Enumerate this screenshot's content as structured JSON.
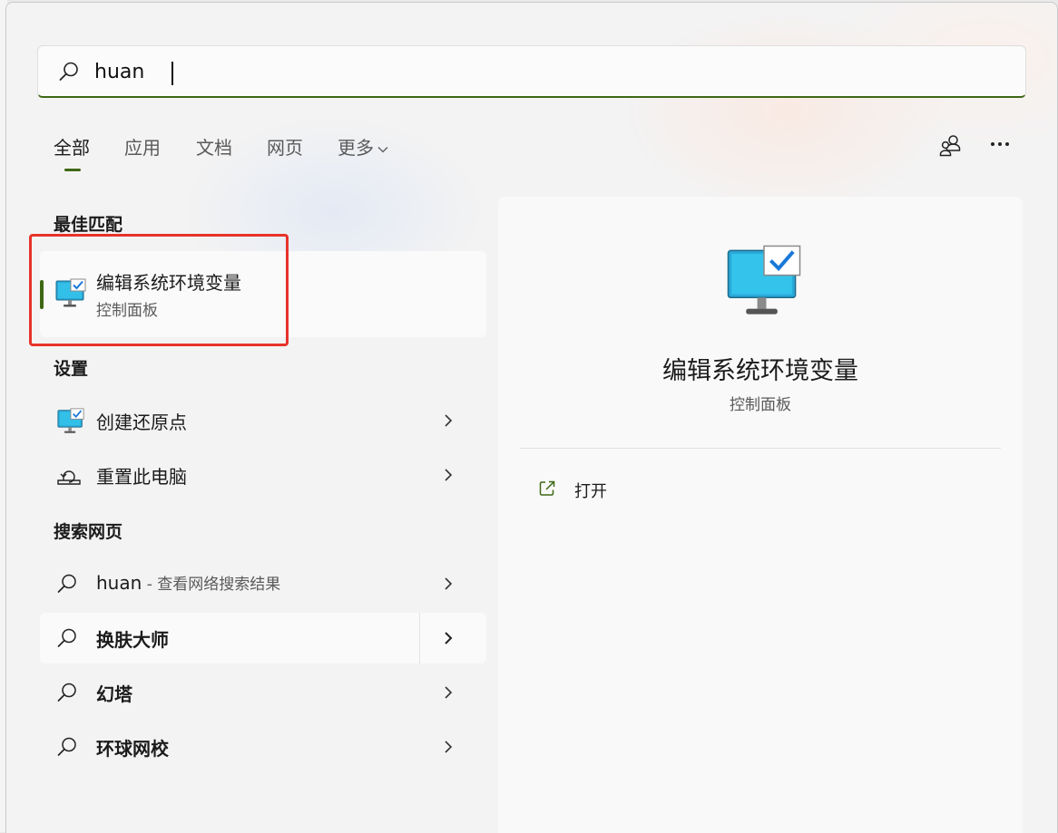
{
  "search": {
    "query": "huan"
  },
  "tabs": [
    {
      "label": "全部",
      "active": true
    },
    {
      "label": "应用"
    },
    {
      "label": "文档"
    },
    {
      "label": "网页"
    },
    {
      "label": "更多"
    }
  ],
  "top_icons": [
    "account-switch-icon",
    "more-icon"
  ],
  "sections": {
    "best_match": "最佳匹配",
    "settings": "设置",
    "web": "搜索网页"
  },
  "best_match": {
    "title": "编辑系统环境变量",
    "subtitle": "控制面板",
    "icon": "system-properties-icon"
  },
  "settings_items": [
    {
      "label": "创建还原点",
      "icon": "system-properties-icon"
    },
    {
      "label": "重置此电脑",
      "icon": "reset-pc-icon"
    }
  ],
  "web_items": [
    {
      "label": "huan",
      "hint": " - 查看网络搜索结果"
    },
    {
      "label": "换肤大师"
    },
    {
      "label": "幻塔"
    },
    {
      "label": "环球网校"
    }
  ],
  "detail": {
    "title": "编辑系统环境变量",
    "subtitle": "控制面板",
    "action_label": "打开"
  },
  "colors": {
    "accent": "#3e6815",
    "highlight_box": "#e8322a"
  }
}
